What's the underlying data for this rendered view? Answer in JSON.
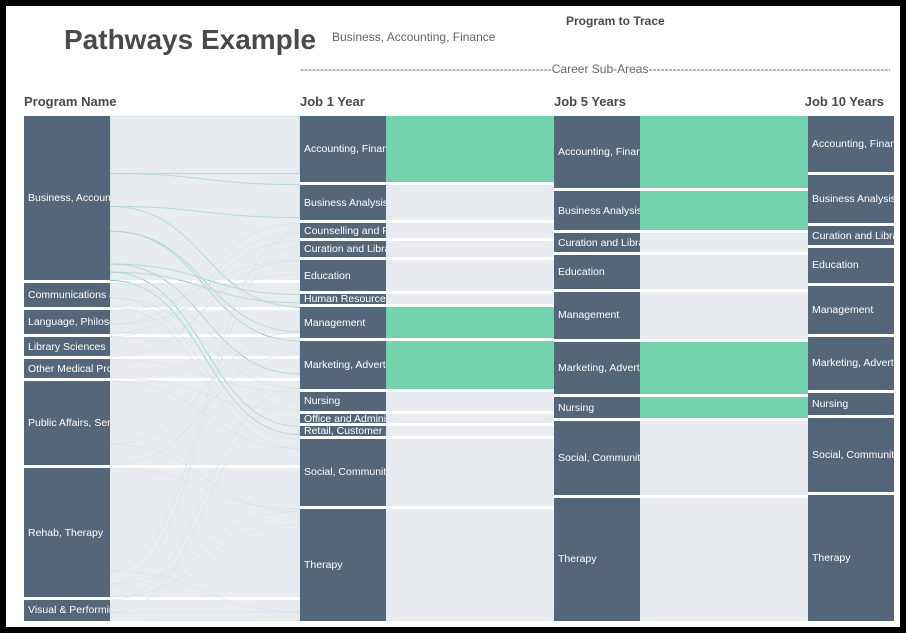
{
  "title": "Pathways Example",
  "trace": {
    "label": "Program to Trace",
    "value": "Business, Accounting, Finance"
  },
  "sub_areas_header": "---------------------------------------------------------------Career Sub-Areas---------------------------------------------------------------",
  "headers": [
    "Program Name",
    "Job 1 Year",
    "Job 5 Years",
    "Job 10 Years"
  ],
  "colors": {
    "node": "#54667a",
    "highlight": "#66cfa5",
    "flow_grey": "#d9e0e6"
  },
  "chart_data": {
    "type": "sankey",
    "traced_program": "Business, Accounting, Finance",
    "stages": [
      {
        "name": "Program Name",
        "nodes": [
          {
            "label": "Business, Accountin",
            "h": 125,
            "traced": true
          },
          {
            "label": "Communications an",
            "h": 18
          },
          {
            "label": "Language, Philosoph",
            "h": 18
          },
          {
            "label": "Library Sciences",
            "h": 15
          },
          {
            "label": "Other Medical Profe",
            "h": 14
          },
          {
            "label": "Public Affairs,  Servic",
            "h": 64
          },
          {
            "label": "Rehab, Therapy",
            "h": 98
          },
          {
            "label": "Visual & Performing",
            "h": 16
          }
        ]
      },
      {
        "name": "Job 1 Year",
        "nodes": [
          {
            "label": "Accounting, Finance",
            "h": 55,
            "traced": true,
            "flow_traced": true
          },
          {
            "label": "Business Analysis, O",
            "h": 30,
            "traced": true,
            "flow_traced": false
          },
          {
            "label": "Counselling and Psy",
            "h": 12
          },
          {
            "label": "Curation and Library",
            "h": 14
          },
          {
            "label": "Education",
            "h": 26
          },
          {
            "label": "Human Resources",
            "h": 8
          },
          {
            "label": "Management",
            "h": 26,
            "traced": true,
            "flow_traced": true
          },
          {
            "label": "Marketing, Advertisi",
            "h": 40,
            "traced": true,
            "flow_traced": true
          },
          {
            "label": "Nursing",
            "h": 16
          },
          {
            "label": "Office and Administ",
            "h": 8
          },
          {
            "label": "Retail, Customer Se",
            "h": 8
          },
          {
            "label": "Social, Community a",
            "h": 56
          },
          {
            "label": "Therapy",
            "h": 94
          }
        ]
      },
      {
        "name": "Job 5 Years",
        "nodes": [
          {
            "label": "Accounting, Finance",
            "h": 55,
            "traced": true,
            "flow_traced": true
          },
          {
            "label": "Business Analysis, O",
            "h": 30,
            "traced": true,
            "flow_traced": true
          },
          {
            "label": "Curation and Library",
            "h": 14
          },
          {
            "label": "Education",
            "h": 26
          },
          {
            "label": "Management",
            "h": 36,
            "traced": true,
            "flow_traced": false
          },
          {
            "label": "Marketing, Advertisi",
            "h": 40,
            "traced": true,
            "flow_traced": true
          },
          {
            "label": "Nursing",
            "h": 16,
            "flow_traced": true
          },
          {
            "label": "Social, Community a",
            "h": 56
          },
          {
            "label": "Therapy",
            "h": 94
          }
        ]
      },
      {
        "name": "Job 10 Years",
        "nodes": [
          {
            "label": "Accounting, Finance",
            "h": 42,
            "traced": true
          },
          {
            "label": "Business Analysis, O",
            "h": 36,
            "traced": true
          },
          {
            "label": "Curation and Library",
            "h": 14
          },
          {
            "label": "Education",
            "h": 26
          },
          {
            "label": "Management",
            "h": 36,
            "traced": true
          },
          {
            "label": "Marketing, Advertisi",
            "h": 40,
            "traced": true
          },
          {
            "label": "Nursing",
            "h": 16
          },
          {
            "label": "Social, Community a",
            "h": 56
          },
          {
            "label": "Therapy",
            "h": 94
          }
        ]
      }
    ]
  }
}
